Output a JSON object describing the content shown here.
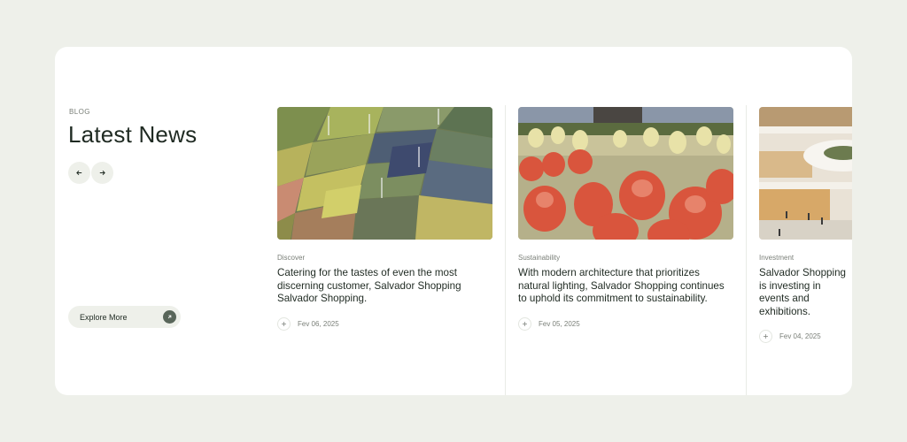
{
  "section": {
    "kicker": "BLOG",
    "title": "Latest News",
    "explore_label": "Explore More"
  },
  "icons": {
    "prev": "arrow-left-icon",
    "next": "arrow-right-icon",
    "explore": "arrow-up-right-icon",
    "plus": "plus-icon"
  },
  "colors": {
    "page_bg": "#eef0ea",
    "card_bg": "#ffffff",
    "accent": "#59665a",
    "text": "#1f2a22",
    "muted": "#7a7f78"
  },
  "posts": [
    {
      "category": "Discover",
      "headline": "Catering for the tastes of even the most discerning customer, Salvador Shopping Salvador Shopping.",
      "date": "Fev 06, 2025",
      "image": "aerial-farmland-wind-turbines"
    },
    {
      "category": "Sustainability",
      "headline": "With modern architecture that prioritizes natural lighting, Salvador Shopping continues to uphold its commitment to sustainability.",
      "date": "Fev 05, 2025",
      "image": "tulip-field-windmill"
    },
    {
      "category": "Investment",
      "headline": "Salvador Shopping is investing in events and exhibitions.",
      "date": "Fev 04, 2025",
      "image": "shopping-mall-interior"
    }
  ]
}
